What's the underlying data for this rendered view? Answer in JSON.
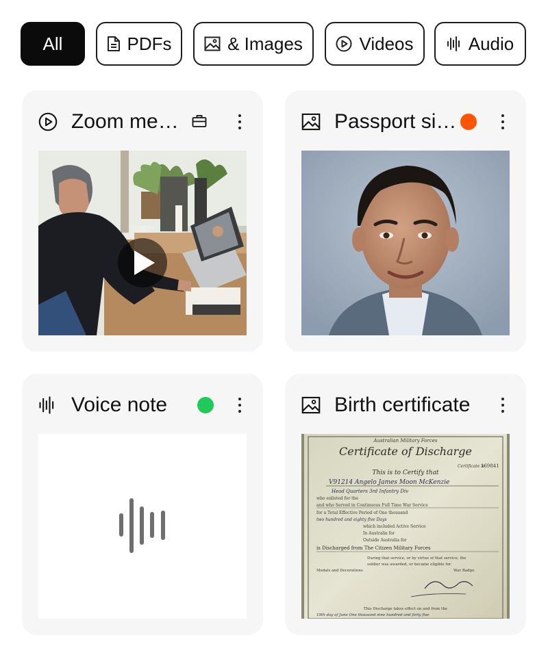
{
  "filters": [
    {
      "label": "All",
      "icon": "none",
      "active": true
    },
    {
      "label": "PDFs",
      "icon": "document-icon",
      "active": false
    },
    {
      "label": "& Images",
      "icon": "image-icon",
      "active": false
    },
    {
      "label": "Videos",
      "icon": "play-circle-icon",
      "active": false
    },
    {
      "label": "Audio",
      "icon": "waveform-icon",
      "active": false
    }
  ],
  "cards": [
    {
      "title": "Zoom me…",
      "type_icon": "play-circle-icon",
      "badge_icon": "briefcase-icon",
      "thumbnail": "video-thumbnail-man-on-video-call"
    },
    {
      "title": "Passport siz…",
      "type_icon": "image-icon",
      "status_color": "#ff5500",
      "thumbnail": "portrait-photo"
    },
    {
      "title": "Voice note",
      "type_icon": "waveform-icon",
      "status_color": "#1fca5b",
      "thumbnail": "audio-waveform"
    },
    {
      "title": "Birth certificate",
      "type_icon": "image-icon",
      "thumbnail": "document-scan"
    }
  ],
  "certificate": {
    "header": "Australian Military Forces",
    "title": "Certificate of Discharge",
    "number_label": "Certificate №",
    "number": "169841",
    "certify": "This is to Certify that",
    "line_name": "V91214 Angelo James Moon McKenzie",
    "line_unit": "Head Quarters 3rd Infantry Div",
    "line_enlisted": "who enlisted for the",
    "line_served": "and who Served in Continuous Full Time War Service",
    "line_period": "for a Total Effective Period of One thousand",
    "line_days": "two hundred and eighty five Days",
    "line_active": "which included Active Service",
    "line_australia": "In Australia for",
    "line_outside": "Outside Australia for",
    "line_discharged": "is Discharged from The Citizen Military Forces",
    "line_during": "During that service, or by virtue of that service, the",
    "line_awarded": "soldier was awarded, or became eligible for",
    "line_medals": "Medals and Decorations",
    "line_badge": "War Badge",
    "line_effect": "This Discharge takes effect on and from the",
    "line_date": "19th day of June One thousand nine hundred and forty five"
  }
}
